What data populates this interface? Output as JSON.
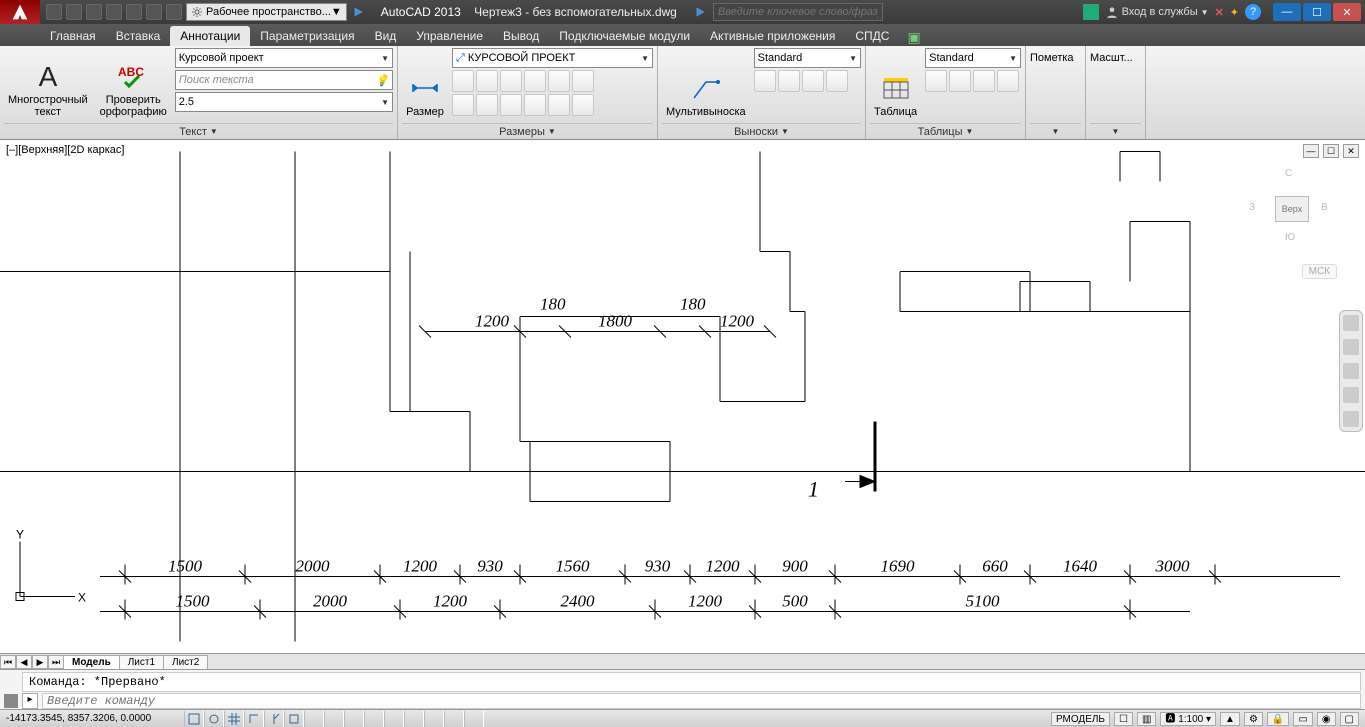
{
  "title": {
    "app": "AutoCAD 2013",
    "doc": "Чертеж3 - без вспомогательных.dwg"
  },
  "workspace_combo": "Рабочее пространство...",
  "search_placeholder": "Введите ключевое слово/фразу",
  "signin": "Вход в службы",
  "tabs": [
    "Главная",
    "Вставка",
    "Аннотации",
    "Параметризация",
    "Вид",
    "Управление",
    "Вывод",
    "Подключаемые модули",
    "Активные приложения",
    "СПДС"
  ],
  "active_tab": 2,
  "panel_text": {
    "mtext": "Многострочный\nтекст",
    "spell": "Проверить\nорфографию",
    "text_style": "Курсовой проект",
    "text_search_ph": "Поиск текста",
    "text_height": "2.5",
    "text_title": "Текст",
    "dim": "Размер",
    "dim_style": "КУРСОВОЙ ПРОЕКТ",
    "dim_title": "Размеры",
    "mleader": "Мультивыноска",
    "mleader_style": "Standard",
    "mleader_title": "Выноски",
    "table": "Таблица",
    "table_style": "Standard",
    "table_title": "Таблицы",
    "markup": "Пометка",
    "scale": "Масшт..."
  },
  "view_label": "[–][Верхняя][2D каркас]",
  "viewcube": {
    "face": "Верх",
    "n": "С",
    "s": "Ю",
    "e": "В",
    "w": "З",
    "mck": "МСК"
  },
  "dimensions_upper": {
    "d1": "180",
    "d2": "180",
    "c1": "1200",
    "c2": "1800",
    "c3": "1200"
  },
  "dimensions_lower1": [
    "1500",
    "2000",
    "1200",
    "930",
    "1560",
    "930",
    "1200",
    "900",
    "1690",
    "660",
    "1640",
    "3000"
  ],
  "dimensions_lower2": [
    "1500",
    "2000",
    "1200",
    "2400",
    "1200",
    "500",
    "5100"
  ],
  "marker_label": "1",
  "layout_tabs": [
    "Модель",
    "Лист1",
    "Лист2"
  ],
  "cmd_history": "Команда: *Прервано*",
  "cmd_placeholder": "Введите команду",
  "status": {
    "coords": "-14173.3545, 8357.3206, 0.0000",
    "model": "РМОДЕЛЬ",
    "scale": "1:100"
  }
}
